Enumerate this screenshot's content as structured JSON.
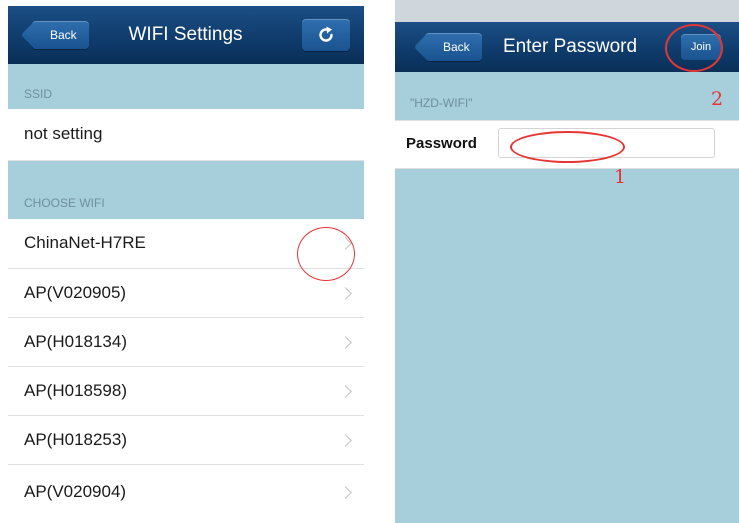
{
  "left_screen": {
    "nav": {
      "back_label": "Back",
      "title": "WIFI Settings",
      "refresh_icon": "refresh-icon"
    },
    "ssid_section": {
      "header": "SSID",
      "value": "not setting"
    },
    "choose_section": {
      "header": "CHOOSE WIFI"
    },
    "networks": [
      {
        "name": "ChinaNet-H7RE"
      },
      {
        "name": "AP(V020905)"
      },
      {
        "name": "AP(H018134)"
      },
      {
        "name": "AP(H018598)"
      },
      {
        "name": "AP(H018253)"
      },
      {
        "name": "AP(V020904)"
      }
    ]
  },
  "right_screen": {
    "nav": {
      "back_label": "Back",
      "title": "Enter Password",
      "join_label": "Join"
    },
    "network_header": "\"HZD-WIFI\"",
    "password": {
      "label": "Password",
      "value": ""
    }
  },
  "annotations": {
    "step_1": "1",
    "step_2": "2",
    "color": "#e53535"
  },
  "colors": {
    "nav_bar": "#0f3c6c",
    "background": "#a6cedb",
    "accent": "#1a5390"
  }
}
